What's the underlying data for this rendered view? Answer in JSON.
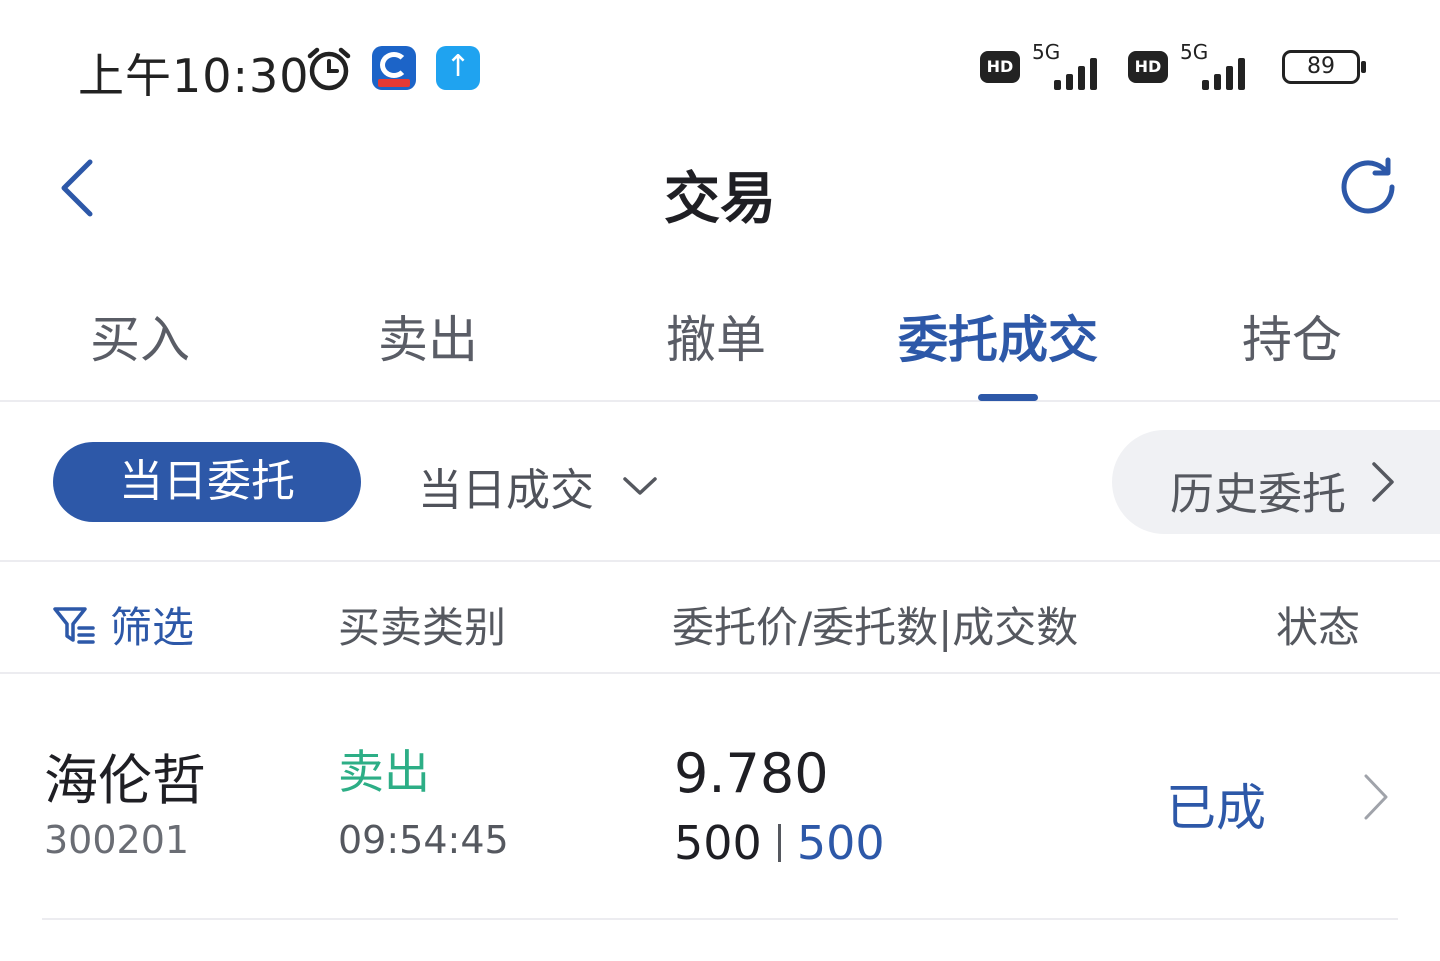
{
  "status_bar": {
    "time": "上午10:30",
    "hd1": "HD",
    "net1": "5G",
    "hd2": "HD",
    "net2": "5G",
    "battery": "89"
  },
  "header": {
    "title": "交易"
  },
  "tabs": [
    {
      "label": "买入",
      "active": false
    },
    {
      "label": "卖出",
      "active": false
    },
    {
      "label": "撤单",
      "active": false
    },
    {
      "label": "委托成交",
      "active": true
    },
    {
      "label": "持仓",
      "active": false
    }
  ],
  "subfilters": {
    "active": "当日委托",
    "dropdown": "当日成交",
    "history": "历史委托"
  },
  "columns": {
    "filter": "筛选",
    "type": "买卖类别",
    "price_qty": "委托价/委托数|成交数",
    "status": "状态"
  },
  "orders": [
    {
      "name": "海伦哲",
      "code": "300201",
      "side": "卖出",
      "time": "09:54:45",
      "price": "9.780",
      "order_qty": "500",
      "deal_qty": "500",
      "status": "已成"
    }
  ],
  "colors": {
    "accent": "#2d58a8",
    "sell": "#2dae86"
  }
}
